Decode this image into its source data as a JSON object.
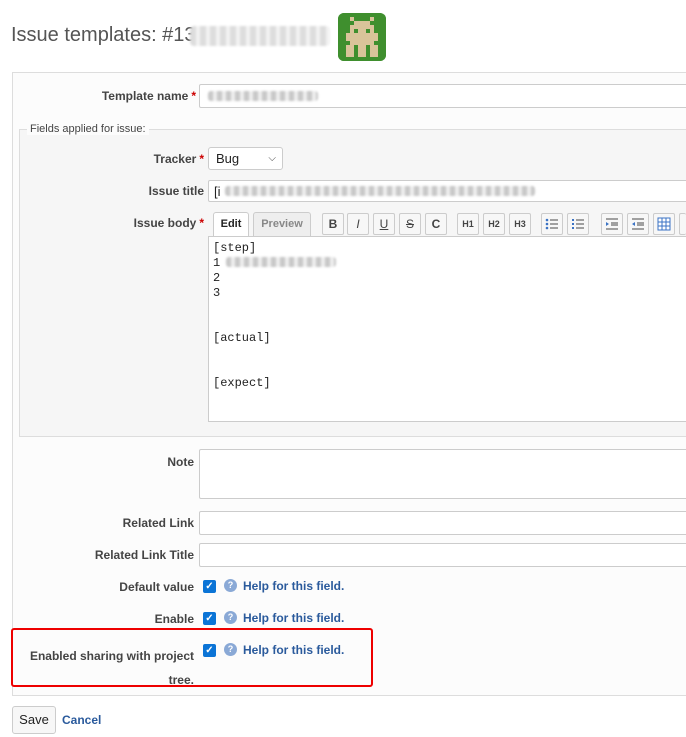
{
  "header": {
    "title": "Issue templates: #13"
  },
  "form": {
    "template_name_label": "Template name",
    "fields_legend": "Fields applied for issue:",
    "tracker_label": "Tracker",
    "tracker_value": "Bug",
    "issue_title_label": "Issue title",
    "issue_title_value": "[i",
    "issue_body_label": "Issue body",
    "tabs": {
      "edit": "Edit",
      "preview": "Preview"
    },
    "toolbar": [
      "B",
      "I",
      "U",
      "S",
      "C",
      "H1",
      "H2",
      "H3"
    ],
    "body_lines": [
      "[step]",
      "1",
      "2",
      "3",
      "",
      "",
      "[actual]",
      "",
      "",
      "[expect]"
    ],
    "note_label": "Note",
    "related_link_label": "Related Link",
    "related_link_title_label": "Related Link Title",
    "default_value_label": "Default value",
    "enable_label": "Enable",
    "sharing_label_line1": "Enabled sharing with project",
    "sharing_label_line2": "tree.",
    "help_text": "Help for this field.",
    "required_mark": "*",
    "check_mark": "✓",
    "help_icon": "?"
  },
  "actions": {
    "save": "Save",
    "cancel": "Cancel"
  },
  "colors": {
    "link": "#2a5a9c",
    "required": "#cc0000",
    "checkbox": "#0b74d6",
    "highlight": "#ee0000"
  }
}
